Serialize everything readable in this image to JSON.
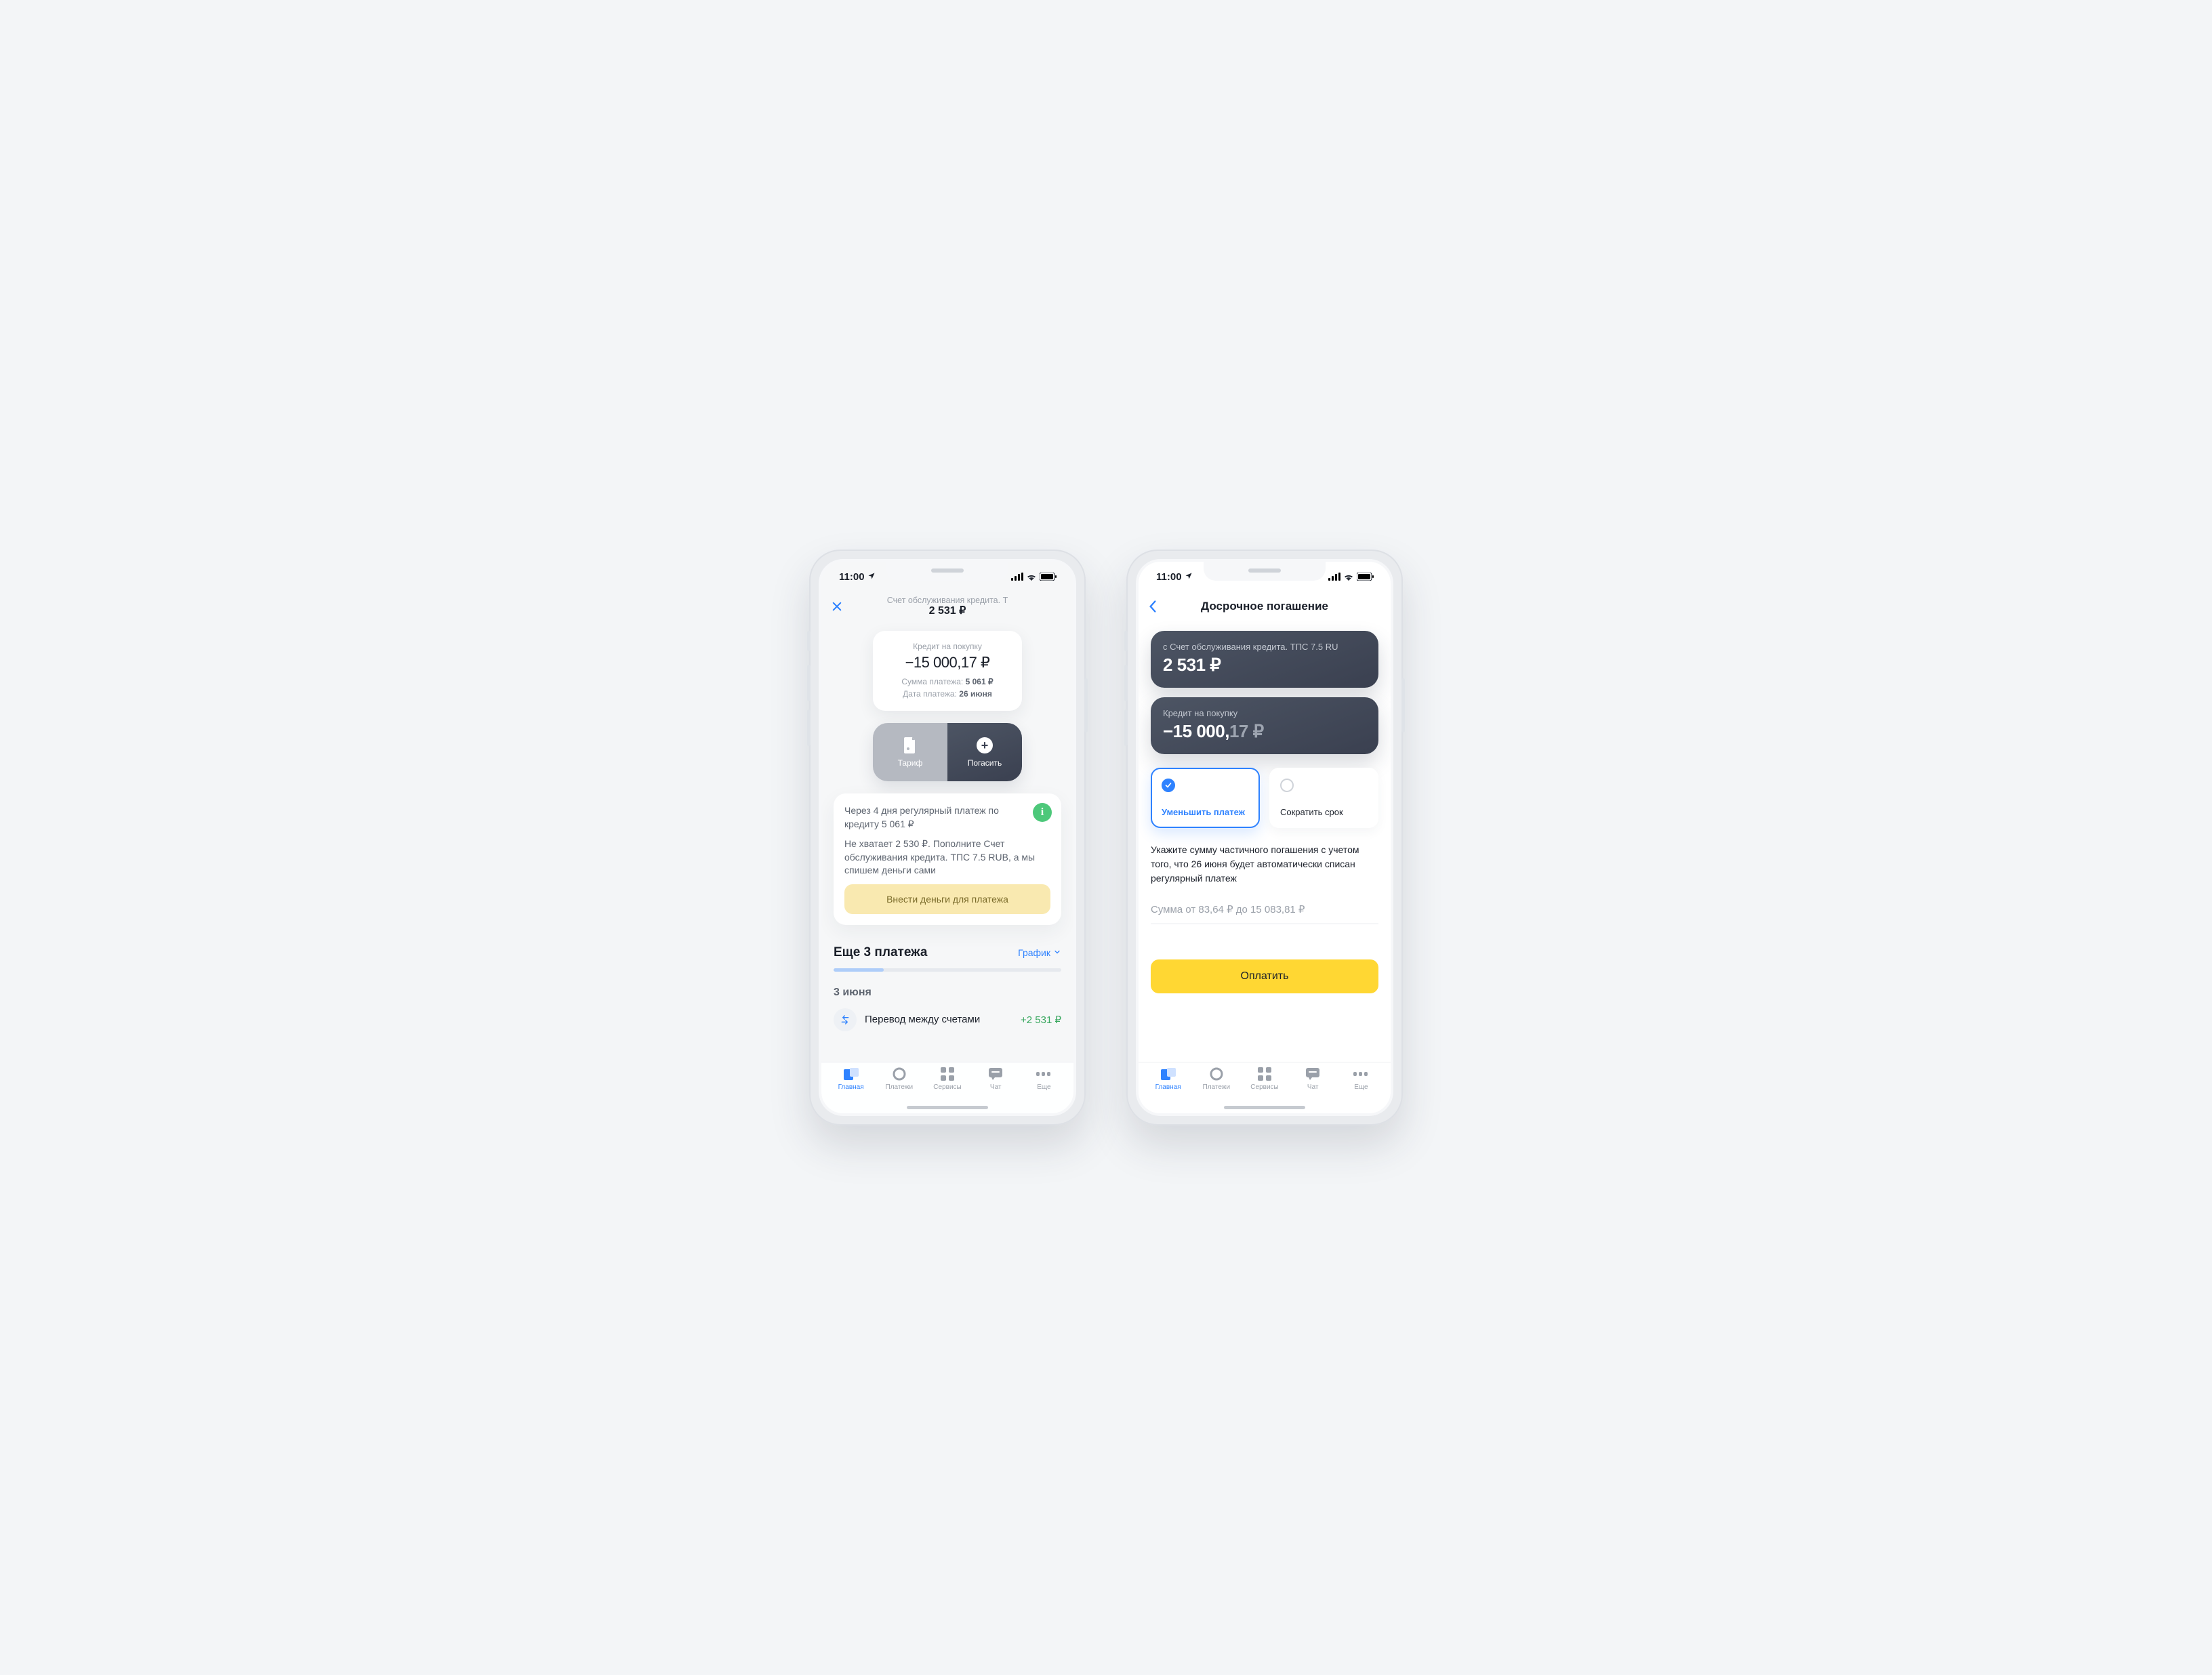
{
  "status": {
    "time": "11:00"
  },
  "phone1": {
    "nav": {
      "subtitle": "Счет обслуживания кредита. Т",
      "amount": "2 531 ₽"
    },
    "card": {
      "label": "Кредит на покупку",
      "balance": "−15 000,17 ₽",
      "sum_label": "Сумма платежа:",
      "sum_value": "5 061 ₽",
      "date_label": "Дата платежа:",
      "date_value": "26 июня"
    },
    "actions": {
      "tariff": "Тариф",
      "repay": "Погасить"
    },
    "notice": {
      "line1": "Через 4 дня регулярный платеж по кредиту 5 061 ₽",
      "line2": "Не хватает 2 530 ₽. Пополните Счет обслуживания кредита. ТПС 7.5 RUB, а мы спишем деньги сами",
      "button": "Внести деньги для платежа"
    },
    "schedule": {
      "title": "Еще 3 платежа",
      "link": "График"
    },
    "day": "3 июня",
    "txn": {
      "title": "Перевод между счетами",
      "amount": "+2 531 ₽"
    }
  },
  "phone2": {
    "nav": {
      "title": "Досрочное погашение"
    },
    "from": {
      "label": "с Счет обслуживания кредита. ТПС 7.5 RU",
      "amount": "2 531 ₽"
    },
    "loan": {
      "label": "Кредит на покупку",
      "amount_major": "−15 000,",
      "amount_minor": "17 ₽"
    },
    "options": {
      "reduce_payment": "Уменьшить платеж",
      "reduce_term": "Сократить срок"
    },
    "hint": "Укажите сумму частичного погашения с учетом того, что 26 июня будет автоматически списан регулярный платеж",
    "input_placeholder": "Сумма от 83,64 ₽ до 15 083,81 ₽",
    "pay_button": "Оплатить"
  },
  "tabs": {
    "home": "Главная",
    "payments": "Платежи",
    "services": "Сервисы",
    "chat": "Чат",
    "more": "Еще"
  }
}
